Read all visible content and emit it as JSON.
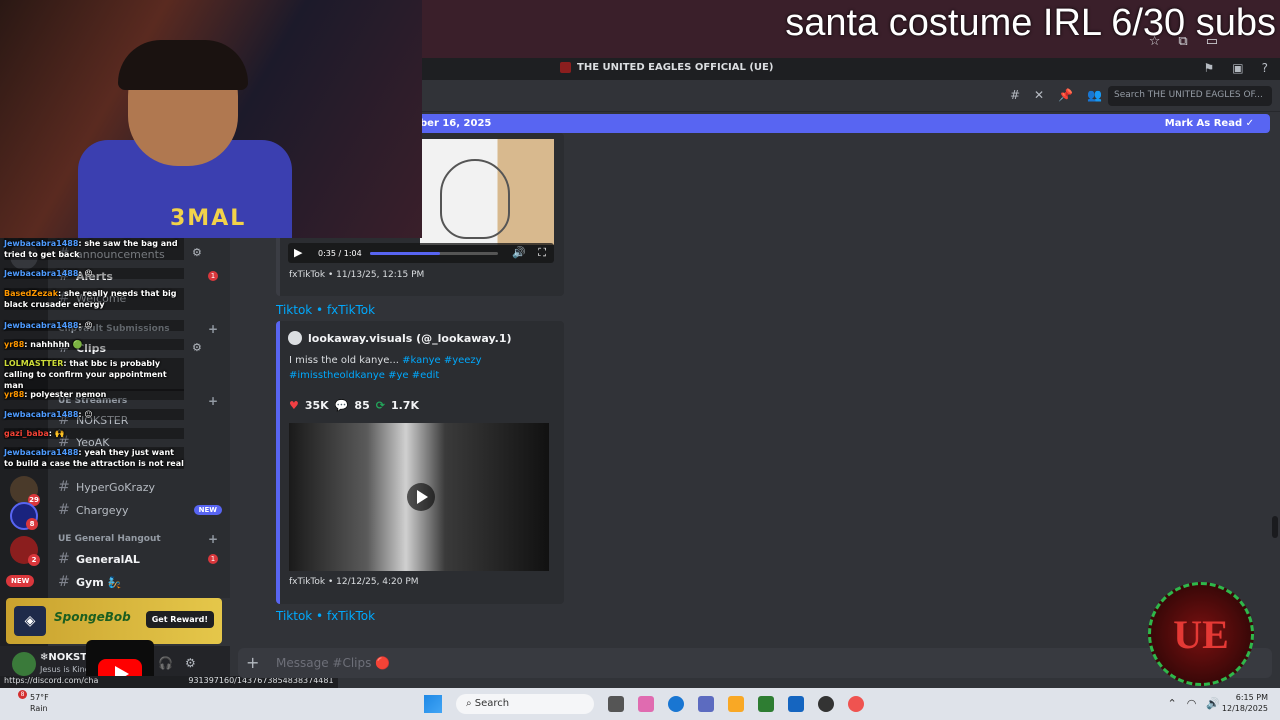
{
  "stream": {
    "title": "santa costume IRL 6/30 subs"
  },
  "window": {
    "server_name": "THE UNITED EAGLES OFFICIAL (UE)"
  },
  "header": {
    "search_placeholder": "Search THE UNITED EAGLES OF..."
  },
  "new_messages_bar": {
    "date_text": "ber 16, 2025",
    "mark_as_read": "Mark As Read"
  },
  "sidebar": {
    "channels": [
      {
        "name": "announcements"
      },
      {
        "name": "Alerts"
      },
      {
        "name": "Welcome"
      },
      {
        "name": "Clips"
      },
      {
        "name": "NOKSTER"
      },
      {
        "name": "YeoAK"
      },
      {
        "name": "HyperGoKrazy"
      },
      {
        "name": "Chargeyy",
        "badge": "NEW"
      },
      {
        "name": "GeneralAL"
      },
      {
        "name": "Gym 🧞"
      }
    ],
    "categories": [
      {
        "name": "Clipvault Submissions"
      },
      {
        "name": "UE Streamers"
      },
      {
        "name": "UE General Hangout"
      }
    ],
    "unread_counts": {
      "alerts": "1",
      "general": "1"
    },
    "guild_badges": [
      "29",
      "8",
      "2"
    ],
    "new_pill": "NEW"
  },
  "promo": {
    "brand": "SpongeBob",
    "button": "Get Reward!"
  },
  "user": {
    "name": "❄NOKSTER",
    "status": "Jesus is King"
  },
  "url_tooltip": "https://discord.com/cha",
  "url_tooltip_tail": "931397160/1437673854838374481",
  "messages": [
    {
      "player_time": "0:35 / 1:04",
      "progress_fraction": 0.55,
      "footer": "fxTikTok • 11/13/25, 12:15 PM"
    },
    {
      "site": "Tiktok • fxTikTok",
      "author": "lookaway.visuals (@_lookaway.1)",
      "text": "I miss the old kanye... ",
      "tags": "#kanye #yeezy #imisstheoldkanye #ye #edit",
      "likes": "35K",
      "comments": "85",
      "reposts": "1.7K",
      "footer": "fxTikTok • 12/12/25, 4:20 PM"
    },
    {
      "site": "Tiktok • fxTikTok"
    }
  ],
  "composer": {
    "placeholder": "Message #Clips 🔴"
  },
  "chat": [
    {
      "user": "Jewbacabra1488",
      "text": "she saw the bag and tried to get back"
    },
    {
      "user": "BasedZezak",
      "text": "she really needs that big black crusader energy"
    },
    {
      "user": "Jewbacabra1488",
      "text": "😡"
    },
    {
      "user": "yr88",
      "text": "nahhhhh 🟢"
    },
    {
      "user": "LOLMASTTER",
      "text": "that bbc is probably calling to confirm your appointment man"
    },
    {
      "user": "yr88",
      "text": "polyester nemon"
    },
    {
      "user": "Jewbacabra1488",
      "text": "😐"
    },
    {
      "user": "gazi_baba",
      "text": "🙌"
    },
    {
      "user": "Jewbacabra1488",
      "text": "yeah they just want to build a case the attraction is not real"
    }
  ],
  "webcam": {
    "jersey_text": "3MAL"
  },
  "logo": {
    "text": "UE"
  },
  "taskbar": {
    "temperature": "57°F",
    "weather": "Rain",
    "weather_badge": "8",
    "search": "Search",
    "time": "6:15 PM",
    "date": "12/18/2025"
  },
  "colors": {
    "accent": "#5865f2",
    "link": "#00a8fc",
    "danger": "#da373c"
  }
}
